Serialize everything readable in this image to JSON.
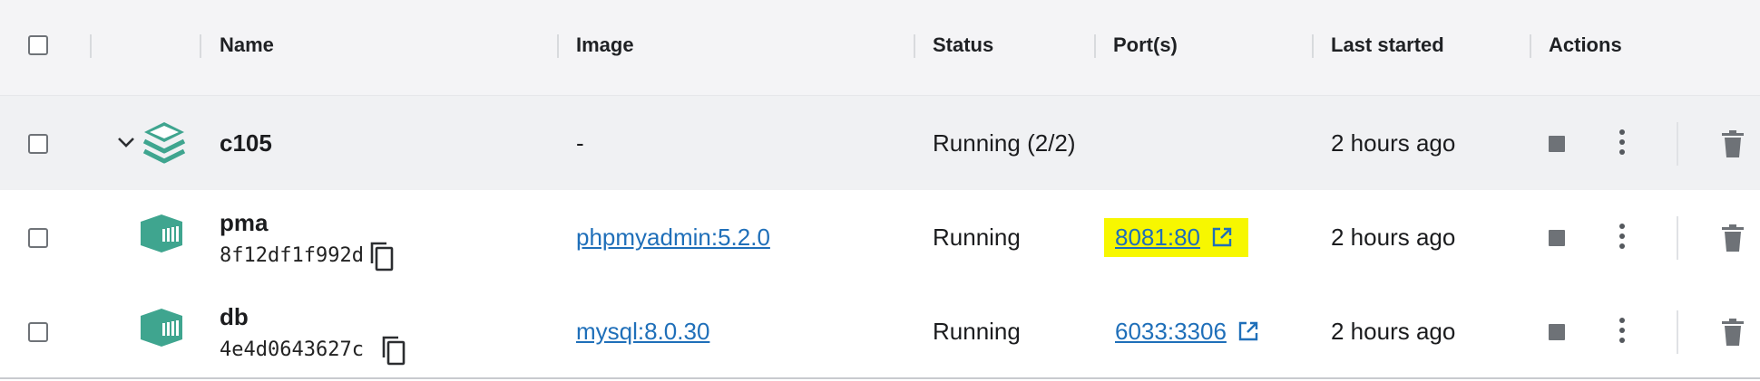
{
  "header": {
    "name": "Name",
    "image": "Image",
    "status": "Status",
    "ports": "Port(s)",
    "last_started": "Last started",
    "actions": "Actions"
  },
  "group": {
    "name": "c105",
    "image": "-",
    "status": "Running (2/2)",
    "last_started": "2 hours ago"
  },
  "containers": [
    {
      "name": "pma",
      "id": "8f12df1f992d",
      "image": "phpmyadmin:5.2.0",
      "status": "Running",
      "port": "8081:80",
      "port_highlighted": true,
      "last_started": "2 hours ago"
    },
    {
      "name": "db",
      "id": "4e4d0643627c",
      "image": "mysql:8.0.30",
      "status": "Running",
      "port": "6033:3306",
      "port_highlighted": false,
      "last_started": "2 hours ago"
    }
  ],
  "colors": {
    "teal": "#3fa58f",
    "link": "#1f6fb9",
    "highlight": "#f7f700"
  }
}
